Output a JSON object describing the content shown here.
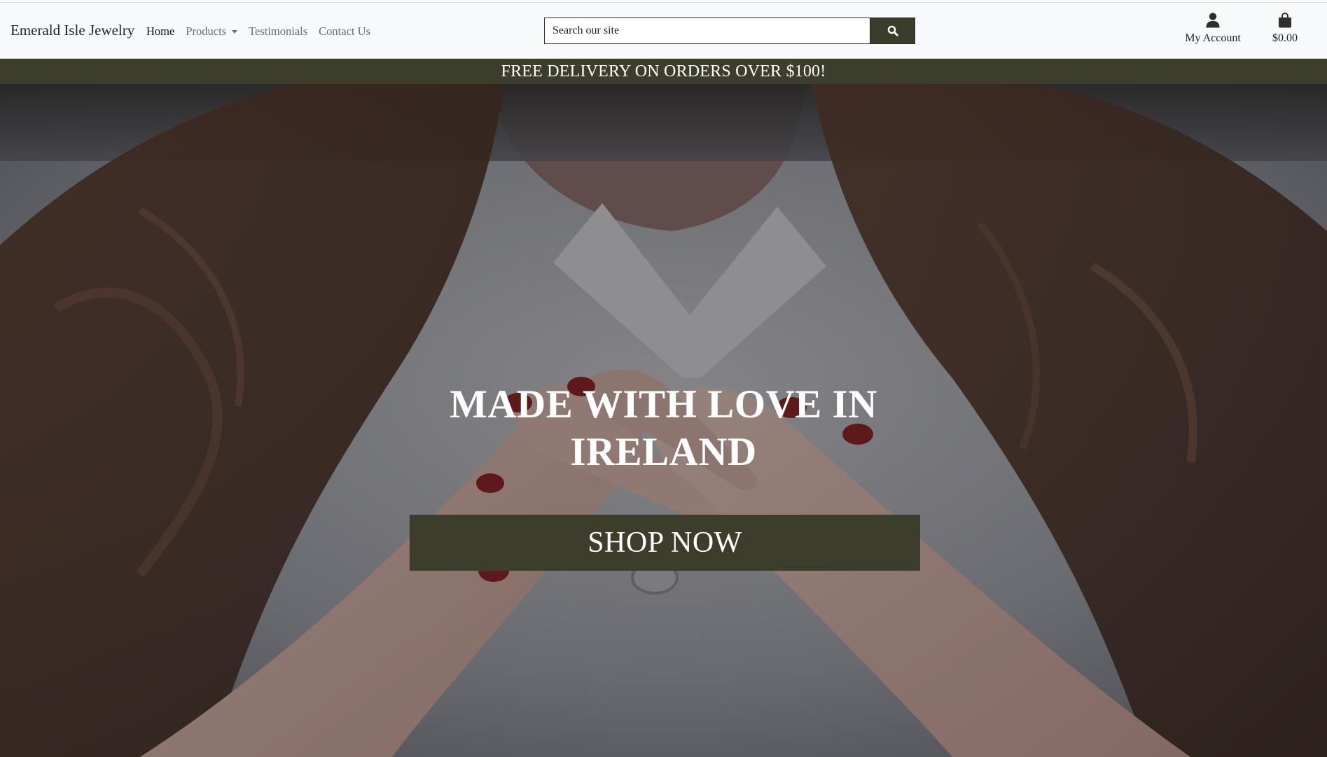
{
  "header": {
    "brand": "Emerald Isle Jewelry",
    "nav": [
      {
        "label": "Home",
        "active": true
      },
      {
        "label": "Products",
        "has_dropdown": true
      },
      {
        "label": "Testimonials"
      },
      {
        "label": "Contact Us"
      }
    ],
    "search": {
      "placeholder": "Search our site",
      "icon": "search-icon"
    },
    "account": {
      "label": "My Account",
      "icon": "user-icon"
    },
    "cart": {
      "total": "$0.00",
      "icon": "shopping-bag-icon"
    }
  },
  "banner": {
    "text": "FREE DELIVERY ON ORDERS OVER $100!"
  },
  "hero": {
    "title_line1": "MADE WITH LOVE IN",
    "title_line2": "IRELAND",
    "button_label": "SHOP NOW"
  },
  "colors": {
    "brand_dark": "#3c3d2b",
    "nav_bg": "#f8f9fa",
    "text_on_dark": "#ffffff"
  }
}
